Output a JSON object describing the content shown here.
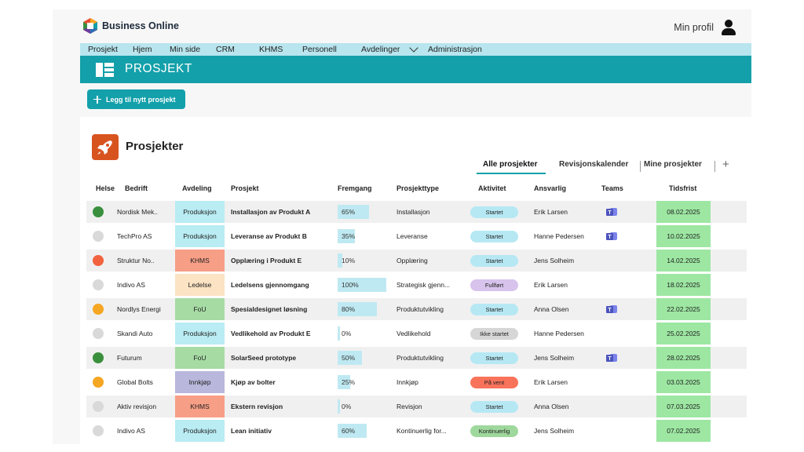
{
  "app": {
    "brand": "Business Online",
    "profile_label": "Min profil"
  },
  "nav": {
    "items": [
      "Prosjekt",
      "Hjem",
      "Min side",
      "CRM",
      "KHMS",
      "Personell",
      "Avdelinger",
      "Administrasjon"
    ]
  },
  "page": {
    "title": "PROSJEKT",
    "add_button": "Legg til nytt prosjekt",
    "section_title": "Prosjekter"
  },
  "tabs": {
    "items": [
      "Alle prosjekter",
      "Revisjonskalender",
      "Mine prosjekter"
    ],
    "active": "Alle prosjekter"
  },
  "table": {
    "headers": [
      "Helse",
      "Bedrift",
      "Avdeling",
      "Prosjekt",
      "Fremgang",
      "Prosjekttype",
      "Aktivitet",
      "Ansvarlig",
      "Teams",
      "Tidsfrist"
    ],
    "rows": [
      {
        "health": "#3a8f3d",
        "company": "Nordisk Mek..",
        "dept": "Produksjon",
        "dept_color": "#b9ecf3",
        "project": "Installasjon av Produkt A",
        "progress_label": "65%",
        "progress": 0.65,
        "type": "Installasjon",
        "status": "Startet",
        "status_color": "#b6e8f4",
        "owner": "Erik Larsen",
        "teams": true,
        "deadline": "08.02.2025"
      },
      {
        "health": "#d9d9d9",
        "company": "TechPro AS",
        "dept": "Produksjon",
        "dept_color": "#b9ecf3",
        "project": "Leveranse av Produkt B",
        "progress_label": "35%",
        "progress": 0.35,
        "type": "Leveranse",
        "status": "Startet",
        "status_color": "#b6e8f4",
        "owner": "Hanne Pedersen",
        "teams": true,
        "deadline": "10.02.2025"
      },
      {
        "health": "#f2623f",
        "company": "Struktur No..",
        "dept": "KHMS",
        "dept_color": "#f79e86",
        "project": "Opplæring i Produkt E",
        "progress_label": "10%",
        "progress": 0.1,
        "type": "Opplæring",
        "status": "Startet",
        "status_color": "#b6e8f4",
        "owner": "Jens Solheim",
        "teams": false,
        "deadline": "14.02.2025"
      },
      {
        "health": "#d9d9d9",
        "company": "Indivo AS",
        "dept": "Ledelse",
        "dept_color": "#fbe3c3",
        "project": "Ledelsens gjennomgang",
        "progress_label": "100%",
        "progress": 1.0,
        "type": "Strategisk gjenn...",
        "status": "Fullført",
        "status_color": "#d7c3ec",
        "owner": "Erik Larsen",
        "teams": false,
        "deadline": "18.02.2025"
      },
      {
        "health": "#f5a623",
        "company": "Nordlys Energi",
        "dept": "FoU",
        "dept_color": "#a6dba4",
        "project": "Spesialdesignet løsning",
        "progress_label": "80%",
        "progress": 0.8,
        "type": "Produktutvikling",
        "status": "Startet",
        "status_color": "#b6e8f4",
        "owner": "Anna Olsen",
        "teams": true,
        "deadline": "22.02.2025"
      },
      {
        "health": "#d9d9d9",
        "company": "Skandi Auto",
        "dept": "Produksjon",
        "dept_color": "#b9ecf3",
        "project": "Vedlikehold av Produkt E",
        "progress_label": "0%",
        "progress": 0.0,
        "type": "Vedlikehold",
        "status": "Ikke startet",
        "status_color": "#d6d6d6",
        "owner": "Hanne Pedersen",
        "teams": false,
        "deadline": "25.02.2025"
      },
      {
        "health": "#3a8f3d",
        "company": "Futurum",
        "dept": "FoU",
        "dept_color": "#a6dba4",
        "project": "SolarSeed prototype",
        "progress_label": "50%",
        "progress": 0.5,
        "type": "Produktutvikling",
        "status": "Startet",
        "status_color": "#b6e8f4",
        "owner": "Jens Solheim",
        "teams": true,
        "deadline": "28.02.2025"
      },
      {
        "health": "#f5a623",
        "company": "Global Bolts",
        "dept": "Innkjøp",
        "dept_color": "#b9b7dc",
        "project": "Kjøp av bolter",
        "progress_label": "25%",
        "progress": 0.25,
        "type": "Innkjøp",
        "status": "På vent",
        "status_color": "#f8735a",
        "owner": "Erik Larsen",
        "teams": false,
        "deadline": "03.03.2025"
      },
      {
        "health": "#d9d9d9",
        "company": "Aktiv revisjon",
        "dept": "KHMS",
        "dept_color": "#f79e86",
        "project": "Ekstern revisjon",
        "progress_label": "0%",
        "progress": 0.0,
        "type": "Revisjon",
        "status": "Startet",
        "status_color": "#b6e8f4",
        "owner": "Anna Olsen",
        "teams": false,
        "deadline": "07.03.2025"
      },
      {
        "health": "#d9d9d9",
        "company": "Indivo AS",
        "dept": "Produksjon",
        "dept_color": "#b9ecf3",
        "project": "Lean initiativ",
        "progress_label": "60%",
        "progress": 0.6,
        "type": "Kontinuerlig for...",
        "status": "Kontinuerlig",
        "status_color": "#9fd89c",
        "owner": "Jens Solheim",
        "teams": false,
        "deadline": "07.02.2025"
      }
    ]
  },
  "colors": {
    "accent": "#13a0aa",
    "nav_bg": "#b8e5ee",
    "deadline_bg": "#9de7a2",
    "rocket_bg": "#d8541f"
  }
}
